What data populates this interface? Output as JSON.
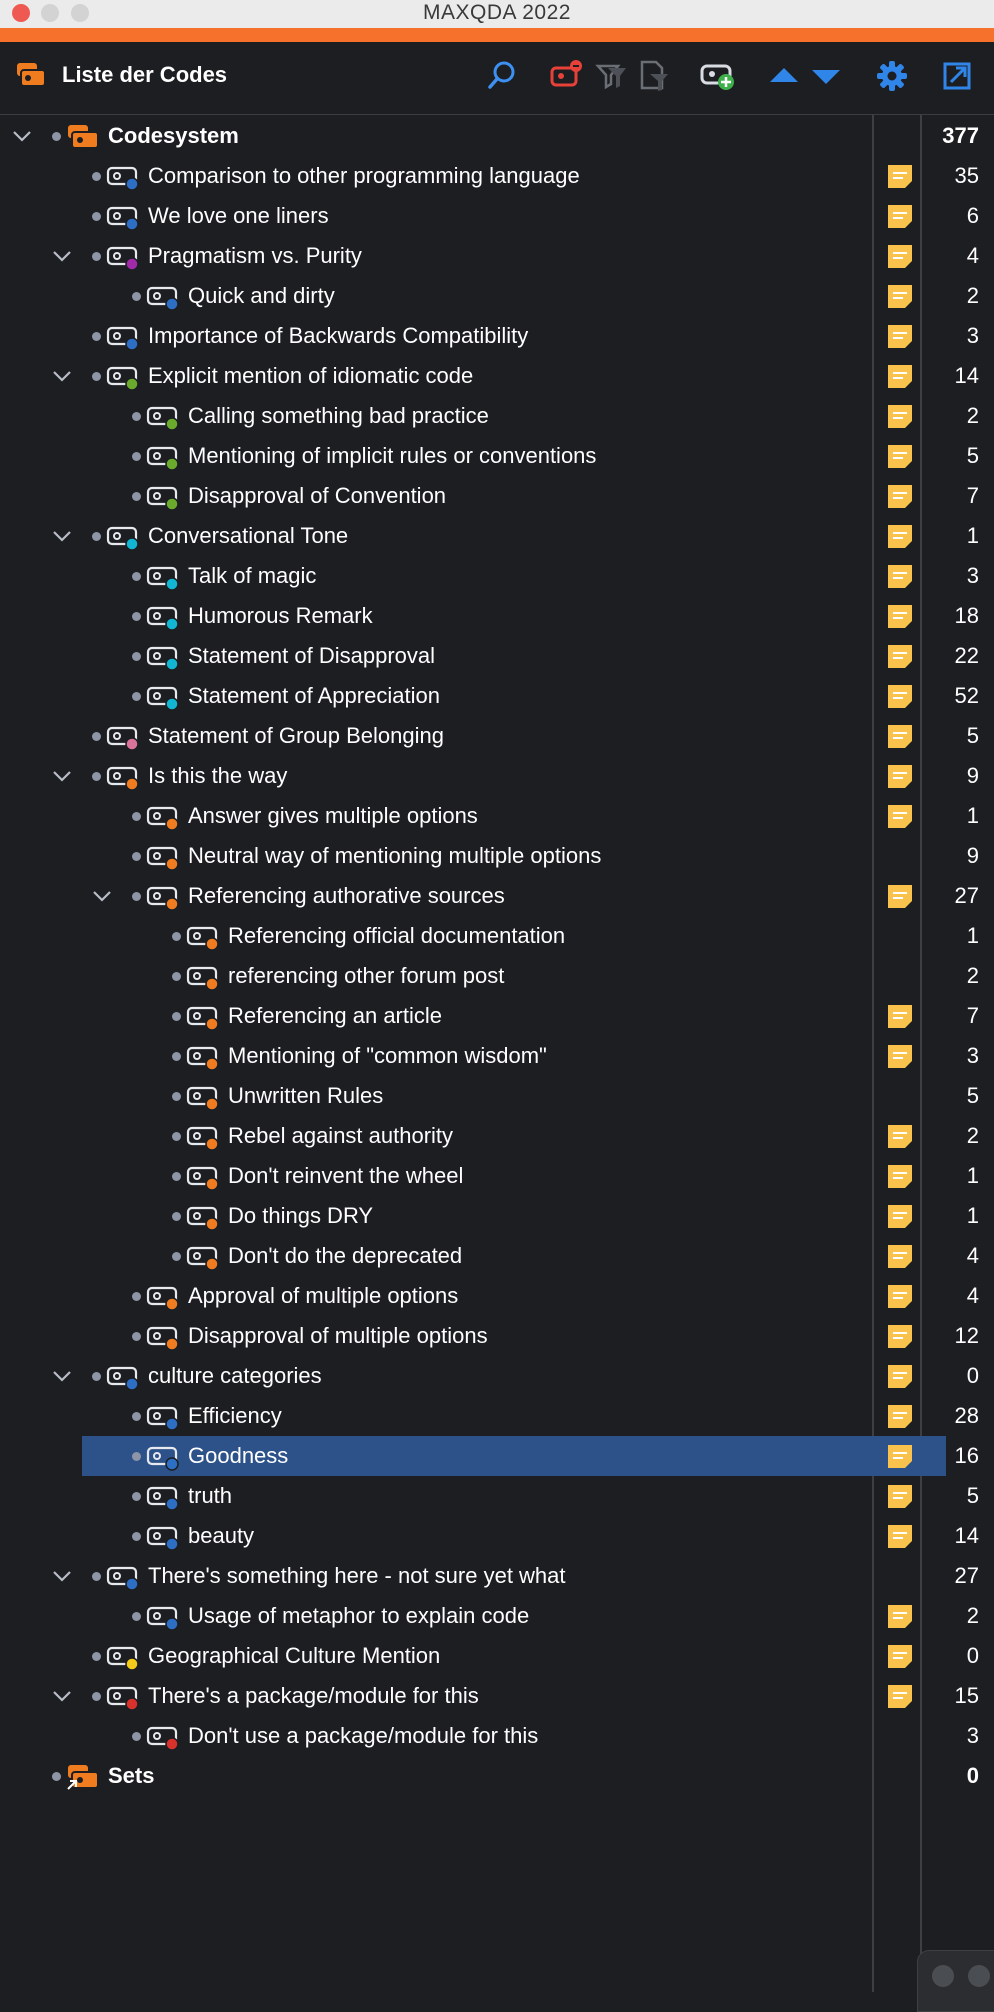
{
  "window": {
    "title": "MAXQDA 2022"
  },
  "toolbar": {
    "title": "Liste der Codes",
    "buttons": [
      {
        "name": "search-button",
        "icon": "search-icon"
      },
      {
        "name": "activate-codes-button",
        "icon": "code-activate-icon"
      },
      {
        "name": "filter-button",
        "icon": "filter-icon"
      },
      {
        "name": "filter-doc-button",
        "icon": "filter-doc-icon"
      },
      {
        "name": "new-code-button",
        "icon": "add-code-icon"
      },
      {
        "name": "move-up-button",
        "icon": "triangle-up-icon"
      },
      {
        "name": "move-down-button",
        "icon": "triangle-down-icon"
      },
      {
        "name": "settings-button",
        "icon": "gear-icon"
      },
      {
        "name": "undock-button",
        "icon": "undock-window-icon"
      }
    ]
  },
  "colors": {
    "accent": "#f5712c",
    "blue": "#2d6fc4",
    "purple": "#a02aa8",
    "green": "#6aab2c",
    "cyan": "#12b6d3",
    "pink": "#d9739a",
    "orange": "#ef7d1f",
    "yellow": "#f2cc19",
    "red": "#d9322c",
    "memo": "#f8c24c",
    "selection": "#2d528a"
  },
  "tree": [
    {
      "label": "Codesystem",
      "count": "377",
      "level": 0,
      "root": true,
      "expandable": true,
      "memo": false,
      "color": "orange"
    },
    {
      "label": "Comparison to other programming language",
      "count": "35",
      "level": 1,
      "color": "blue",
      "memo": true
    },
    {
      "label": "We love one liners",
      "count": "6",
      "level": 1,
      "color": "blue",
      "memo": true
    },
    {
      "label": "Pragmatism vs. Purity",
      "count": "4",
      "level": 1,
      "color": "purple",
      "memo": true,
      "expandable": true
    },
    {
      "label": "Quick and dirty",
      "count": "2",
      "level": 2,
      "color": "blue",
      "memo": true
    },
    {
      "label": "Importance of Backwards Compatibility",
      "count": "3",
      "level": 1,
      "color": "blue",
      "memo": true
    },
    {
      "label": "Explicit mention of idiomatic code",
      "count": "14",
      "level": 1,
      "color": "green",
      "memo": true,
      "expandable": true
    },
    {
      "label": "Calling something bad practice",
      "count": "2",
      "level": 2,
      "color": "green",
      "memo": true
    },
    {
      "label": "Mentioning of implicit rules or conventions",
      "count": "5",
      "level": 2,
      "color": "green",
      "memo": true
    },
    {
      "label": "Disapproval of Convention",
      "count": "7",
      "level": 2,
      "color": "green",
      "memo": true
    },
    {
      "label": "Conversational Tone",
      "count": "1",
      "level": 1,
      "color": "cyan",
      "memo": true,
      "expandable": true
    },
    {
      "label": "Talk of magic",
      "count": "3",
      "level": 2,
      "color": "cyan",
      "memo": true
    },
    {
      "label": "Humorous Remark",
      "count": "18",
      "level": 2,
      "color": "cyan",
      "memo": true
    },
    {
      "label": "Statement of Disapproval",
      "count": "22",
      "level": 2,
      "color": "cyan",
      "memo": true
    },
    {
      "label": "Statement of Appreciation",
      "count": "52",
      "level": 2,
      "color": "cyan",
      "memo": true
    },
    {
      "label": "Statement of Group Belonging",
      "count": "5",
      "level": 1,
      "color": "pink",
      "memo": true
    },
    {
      "label": "Is this the way",
      "count": "9",
      "level": 1,
      "color": "orange",
      "memo": true,
      "expandable": true
    },
    {
      "label": "Answer gives multiple options",
      "count": "1",
      "level": 2,
      "color": "orange",
      "memo": true
    },
    {
      "label": "Neutral way of mentioning multiple options",
      "count": "9",
      "level": 2,
      "color": "orange",
      "memo": false
    },
    {
      "label": "Referencing authorative sources",
      "count": "27",
      "level": 2,
      "color": "orange",
      "memo": true,
      "expandable": true
    },
    {
      "label": "Referencing official documentation",
      "count": "1",
      "level": 3,
      "color": "orange",
      "memo": false
    },
    {
      "label": "referencing other forum post",
      "count": "2",
      "level": 3,
      "color": "orange",
      "memo": false
    },
    {
      "label": "Referencing an article",
      "count": "7",
      "level": 3,
      "color": "orange",
      "memo": true
    },
    {
      "label": "Mentioning of \"common wisdom\"",
      "count": "3",
      "level": 3,
      "color": "orange",
      "memo": true
    },
    {
      "label": "Unwritten Rules",
      "count": "5",
      "level": 3,
      "color": "orange",
      "memo": false
    },
    {
      "label": "Rebel against authority",
      "count": "2",
      "level": 3,
      "color": "orange",
      "memo": true
    },
    {
      "label": "Don't reinvent the wheel",
      "count": "1",
      "level": 3,
      "color": "orange",
      "memo": true
    },
    {
      "label": "Do things DRY",
      "count": "1",
      "level": 3,
      "color": "orange",
      "memo": true
    },
    {
      "label": "Don't do the deprecated",
      "count": "4",
      "level": 3,
      "color": "orange",
      "memo": true
    },
    {
      "label": "Approval of multiple options",
      "count": "4",
      "level": 2,
      "color": "orange",
      "memo": true
    },
    {
      "label": "Disapproval of multiple options",
      "count": "12",
      "level": 2,
      "color": "orange",
      "memo": true
    },
    {
      "label": "culture categories",
      "count": "0",
      "level": 1,
      "color": "blue",
      "memo": true,
      "expandable": true
    },
    {
      "label": "Efficiency",
      "count": "28",
      "level": 2,
      "color": "blue",
      "memo": true
    },
    {
      "label": "Goodness",
      "count": "16",
      "level": 2,
      "color": "blue",
      "memo": true,
      "selected": true
    },
    {
      "label": "truth",
      "count": "5",
      "level": 2,
      "color": "blue",
      "memo": true
    },
    {
      "label": "beauty",
      "count": "14",
      "level": 2,
      "color": "blue",
      "memo": true
    },
    {
      "label": "There's something here - not sure yet what",
      "count": "27",
      "level": 1,
      "color": "blue",
      "memo": false,
      "expandable": true
    },
    {
      "label": "Usage of metaphor to explain code",
      "count": "2",
      "level": 2,
      "color": "blue",
      "memo": true
    },
    {
      "label": "Geographical Culture Mention",
      "count": "0",
      "level": 1,
      "color": "yellow",
      "memo": true
    },
    {
      "label": "There's a package/module for this",
      "count": "15",
      "level": 1,
      "color": "red",
      "memo": true,
      "expandable": true
    },
    {
      "label": "Don't use a package/module for this",
      "count": "3",
      "level": 2,
      "color": "red",
      "memo": false
    },
    {
      "label": "Sets",
      "count": "0",
      "level": 0,
      "root": true,
      "sets": true,
      "memo": false,
      "color": "orange"
    }
  ]
}
